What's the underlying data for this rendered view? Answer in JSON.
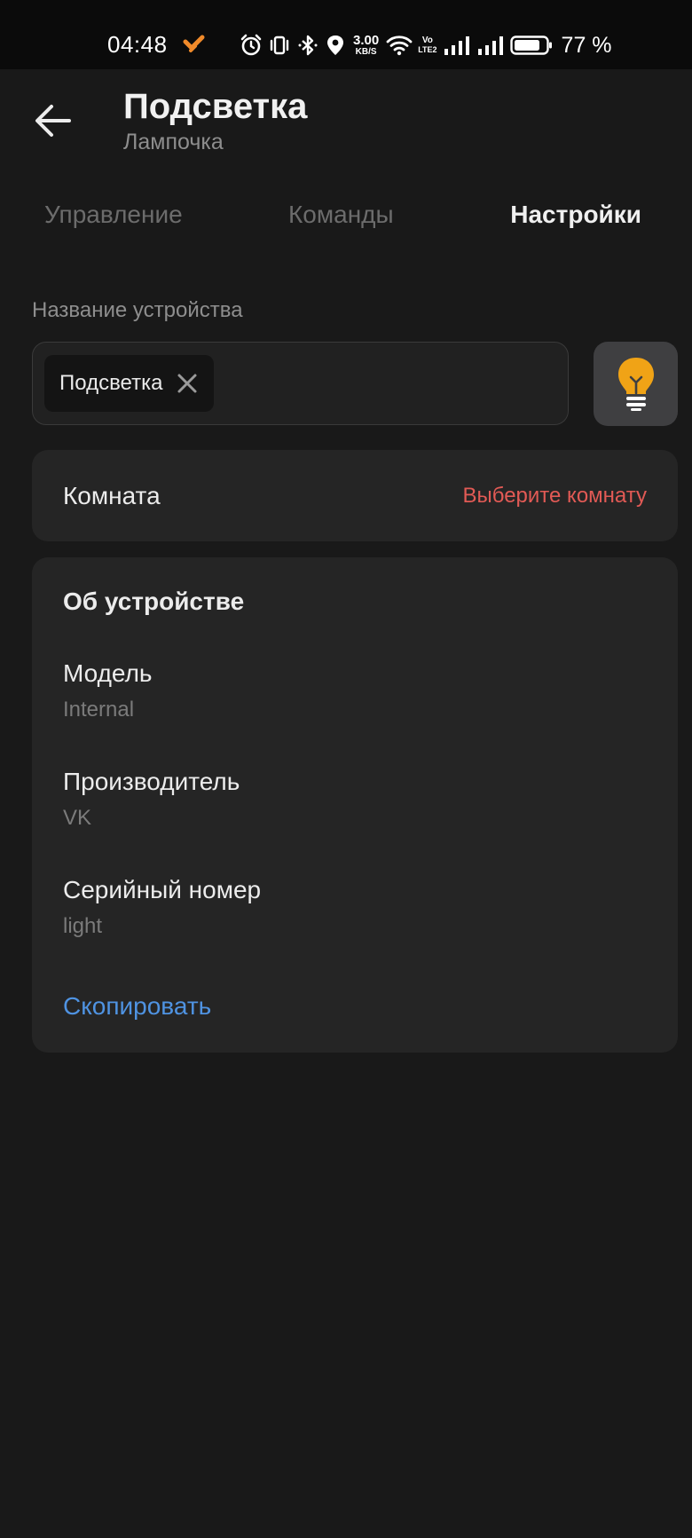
{
  "status_bar": {
    "time": "04:48",
    "net_speed_value": "3.00",
    "net_speed_unit": "KB/S",
    "volte_top": "Vo",
    "volte_bottom": "LTE2",
    "battery": "77 %",
    "icons": [
      "app-notification-icon",
      "alarm-icon",
      "vibrate-icon",
      "bluetooth-icon",
      "location-icon",
      "wifi-icon",
      "signal-icon",
      "signal-icon",
      "battery-icon"
    ]
  },
  "header": {
    "title": "Подсветка",
    "subtitle": "Лампочка",
    "back_icon": "arrow-left-icon"
  },
  "tabs": [
    {
      "label": "Управление",
      "active": false
    },
    {
      "label": "Команды",
      "active": false
    },
    {
      "label": "Настройки",
      "active": true
    }
  ],
  "device_name": {
    "label": "Название устройства",
    "value": "Подсветка",
    "clear_icon": "close-icon",
    "device_icon": "lightbulb-icon",
    "device_icon_color": "#f0a316"
  },
  "room": {
    "label": "Комната",
    "value": "Выберите комнату",
    "value_color": "#e25a55"
  },
  "about": {
    "title": "Об устройстве",
    "properties": [
      {
        "label": "Модель",
        "value": "Internal"
      },
      {
        "label": "Производитель",
        "value": "VK"
      },
      {
        "label": "Серийный номер",
        "value": "light"
      }
    ],
    "copy_label": "Скопировать",
    "link_color": "#4f93e2"
  },
  "colors": {
    "background": "#191919",
    "card": "#252525",
    "accent_orange": "#f0a316"
  }
}
